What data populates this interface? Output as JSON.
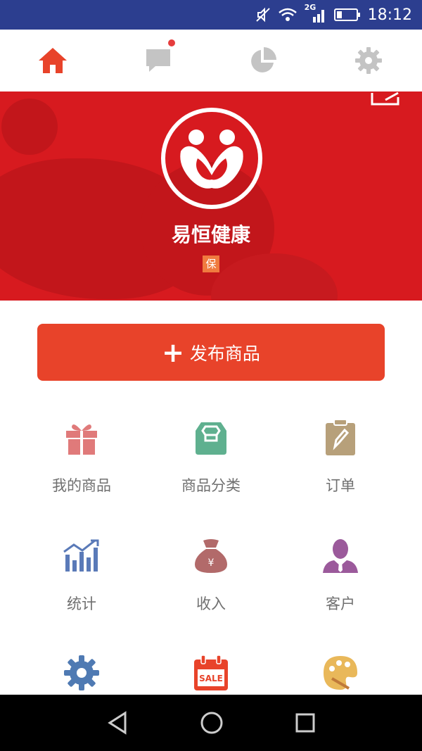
{
  "status_bar": {
    "time": "18:12",
    "network": "2G"
  },
  "top_nav": {
    "tabs": [
      {
        "icon": "home-icon",
        "active": true
      },
      {
        "icon": "message-icon",
        "has_notification": true
      },
      {
        "icon": "pie-chart-icon"
      },
      {
        "icon": "gear-icon"
      }
    ],
    "active_color": "#e8432a",
    "inactive_color": "#c4c4c4"
  },
  "shop": {
    "name": "易恒健康",
    "badge": "保",
    "banner_color": "#d71a1f"
  },
  "publish_button": {
    "label": "发布商品",
    "color": "#e8432a"
  },
  "menu": [
    {
      "label": "我的商品",
      "icon": "gift-icon",
      "color": "#e07a7a"
    },
    {
      "label": "商品分类",
      "icon": "category-box-icon",
      "color": "#5fb08f"
    },
    {
      "label": "订单",
      "icon": "clipboard-icon",
      "color": "#b7a07a"
    },
    {
      "label": "统计",
      "icon": "statistics-chart-icon",
      "color": "#5a7ab8"
    },
    {
      "label": "收入",
      "icon": "money-bag-icon",
      "color": "#b26a6a"
    },
    {
      "label": "客户",
      "icon": "customer-icon",
      "color": "#9b5a9b"
    },
    {
      "label": "",
      "icon": "settings-gear-icon",
      "color": "#4f7ab3"
    },
    {
      "label": "",
      "icon": "sale-calendar-icon",
      "color": "#e8432a"
    },
    {
      "label": "",
      "icon": "palette-icon",
      "color": "#e9b85a"
    }
  ]
}
